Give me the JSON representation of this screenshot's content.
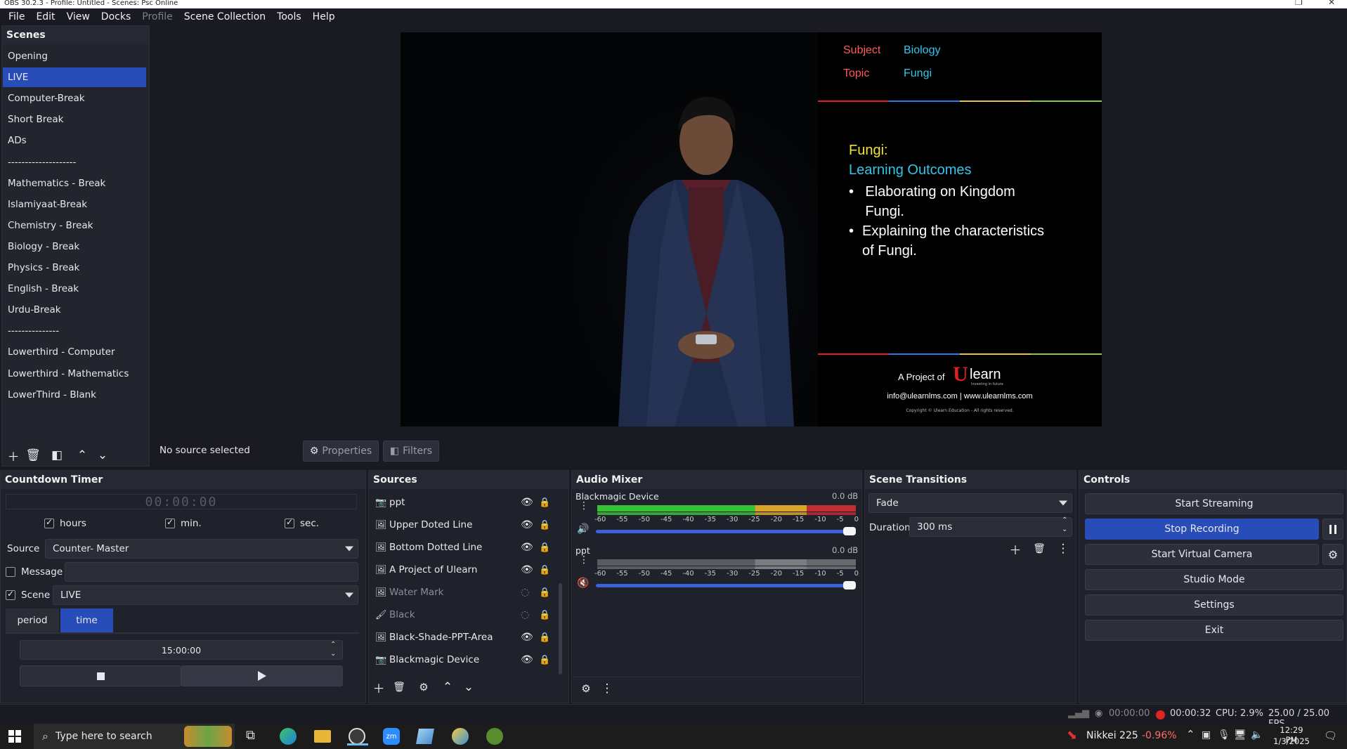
{
  "window": {
    "title": "OBS 30.2.3 - Profile: Untitled - Scenes: Psc Online"
  },
  "menu": [
    "File",
    "Edit",
    "View",
    "Docks",
    "Profile",
    "Scene Collection",
    "Tools",
    "Help"
  ],
  "scenes": {
    "title": "Scenes",
    "items": [
      "Opening",
      "LIVE",
      "Computer-Break",
      "Short Break",
      "ADs",
      "--------------------",
      "Mathematics  - Break",
      "Islamiyaat-Break",
      "Chemistry  - Break",
      "Biology  - Break",
      "Physics  - Break",
      "English - Break",
      "Urdu-Break",
      "---------------",
      "Lowerthird - Computer",
      "Lowerthird - Mathematics",
      "LowerThird - Blank"
    ],
    "active_index": 1
  },
  "preview": {
    "subject_label": "Subject",
    "subject_value": "Biology",
    "topic_label": "Topic",
    "topic_value": "Fungi",
    "slide_heading": "Fungi:",
    "slide_sub": "Learning Outcomes",
    "bullets": [
      "Elaborating on Kingdom Fungi.",
      "Explaining the characteristics of Fungi."
    ],
    "project_of": "A Project of",
    "brand": "learn",
    "brand_u": "U",
    "brand_tag": "Investing in future",
    "contact": "info@ulearnlms.com | www.ulearnlms.com",
    "copyright": "Copyright © Ulearn Education - All rights reserved."
  },
  "source_bar": {
    "status": "No source selected",
    "properties": "Properties",
    "filters": "Filters"
  },
  "countdown": {
    "title": "Countdown Timer",
    "display": "00:00:00",
    "hours": "hours",
    "min": "min.",
    "sec": "sec.",
    "source_label": "Source",
    "source_value": "Counter- Master",
    "message_label": "Message",
    "scene_label": "Scene",
    "scene_value": "LIVE",
    "tab_period": "period",
    "tab_time": "time",
    "time_value": "15:00:00"
  },
  "sources": {
    "title": "Sources",
    "items": [
      {
        "name": "ppt",
        "icon": "camera-icon",
        "visible": true
      },
      {
        "name": "Upper Doted Line",
        "icon": "image-icon",
        "visible": true
      },
      {
        "name": "Bottom Dotted Line",
        "icon": "image-icon",
        "visible": true
      },
      {
        "name": "A Project of Ulearn",
        "icon": "image-icon",
        "visible": true
      },
      {
        "name": "Water Mark",
        "icon": "image-icon",
        "visible": false
      },
      {
        "name": "Black",
        "icon": "brush-icon",
        "visible": false
      },
      {
        "name": "Black-Shade-PPT-Area",
        "icon": "image-icon",
        "visible": true
      },
      {
        "name": "Blackmagic Device",
        "icon": "camera-icon",
        "visible": true
      }
    ]
  },
  "audio": {
    "title": "Audio Mixer",
    "scale": [
      "-60",
      "-55",
      "-50",
      "-45",
      "-40",
      "-35",
      "-30",
      "-25",
      "-20",
      "-15",
      "-10",
      "-5",
      "0"
    ],
    "channels": [
      {
        "name": "Blackmagic Device",
        "db": "0.0 dB",
        "muted": false,
        "level": 0.92,
        "volume": 1.0
      },
      {
        "name": "ppt",
        "db": "0.0 dB",
        "muted": true,
        "level": 0.0,
        "volume": 1.0
      }
    ]
  },
  "transitions": {
    "title": "Scene Transitions",
    "type": "Fade",
    "duration_label": "Duration",
    "duration_value": "300 ms"
  },
  "controls": {
    "title": "Controls",
    "start_streaming": "Start Streaming",
    "stop_recording": "Stop Recording",
    "start_virtual_camera": "Start Virtual Camera",
    "studio_mode": "Studio Mode",
    "settings": "Settings",
    "exit": "Exit"
  },
  "status": {
    "stream_time": "00:00:00",
    "rec_time": "00:00:32",
    "cpu": "CPU: 2.9%",
    "fps": "25.00 / 25.00 FPS"
  },
  "taskbar": {
    "search_placeholder": "Type here to search",
    "ticker": "Nikkei 225",
    "ticker_change": "-0.96%",
    "time": "12:29 PM",
    "date": "1/3/2025"
  },
  "colors": {
    "accent": "#284cb8",
    "bg": "#1a1b22",
    "panel": "#20222b",
    "record": "#e02424",
    "label_red": "#ff5a5a",
    "label_cyan": "#33c6ea",
    "slide_yellow": "#f4e03a"
  }
}
